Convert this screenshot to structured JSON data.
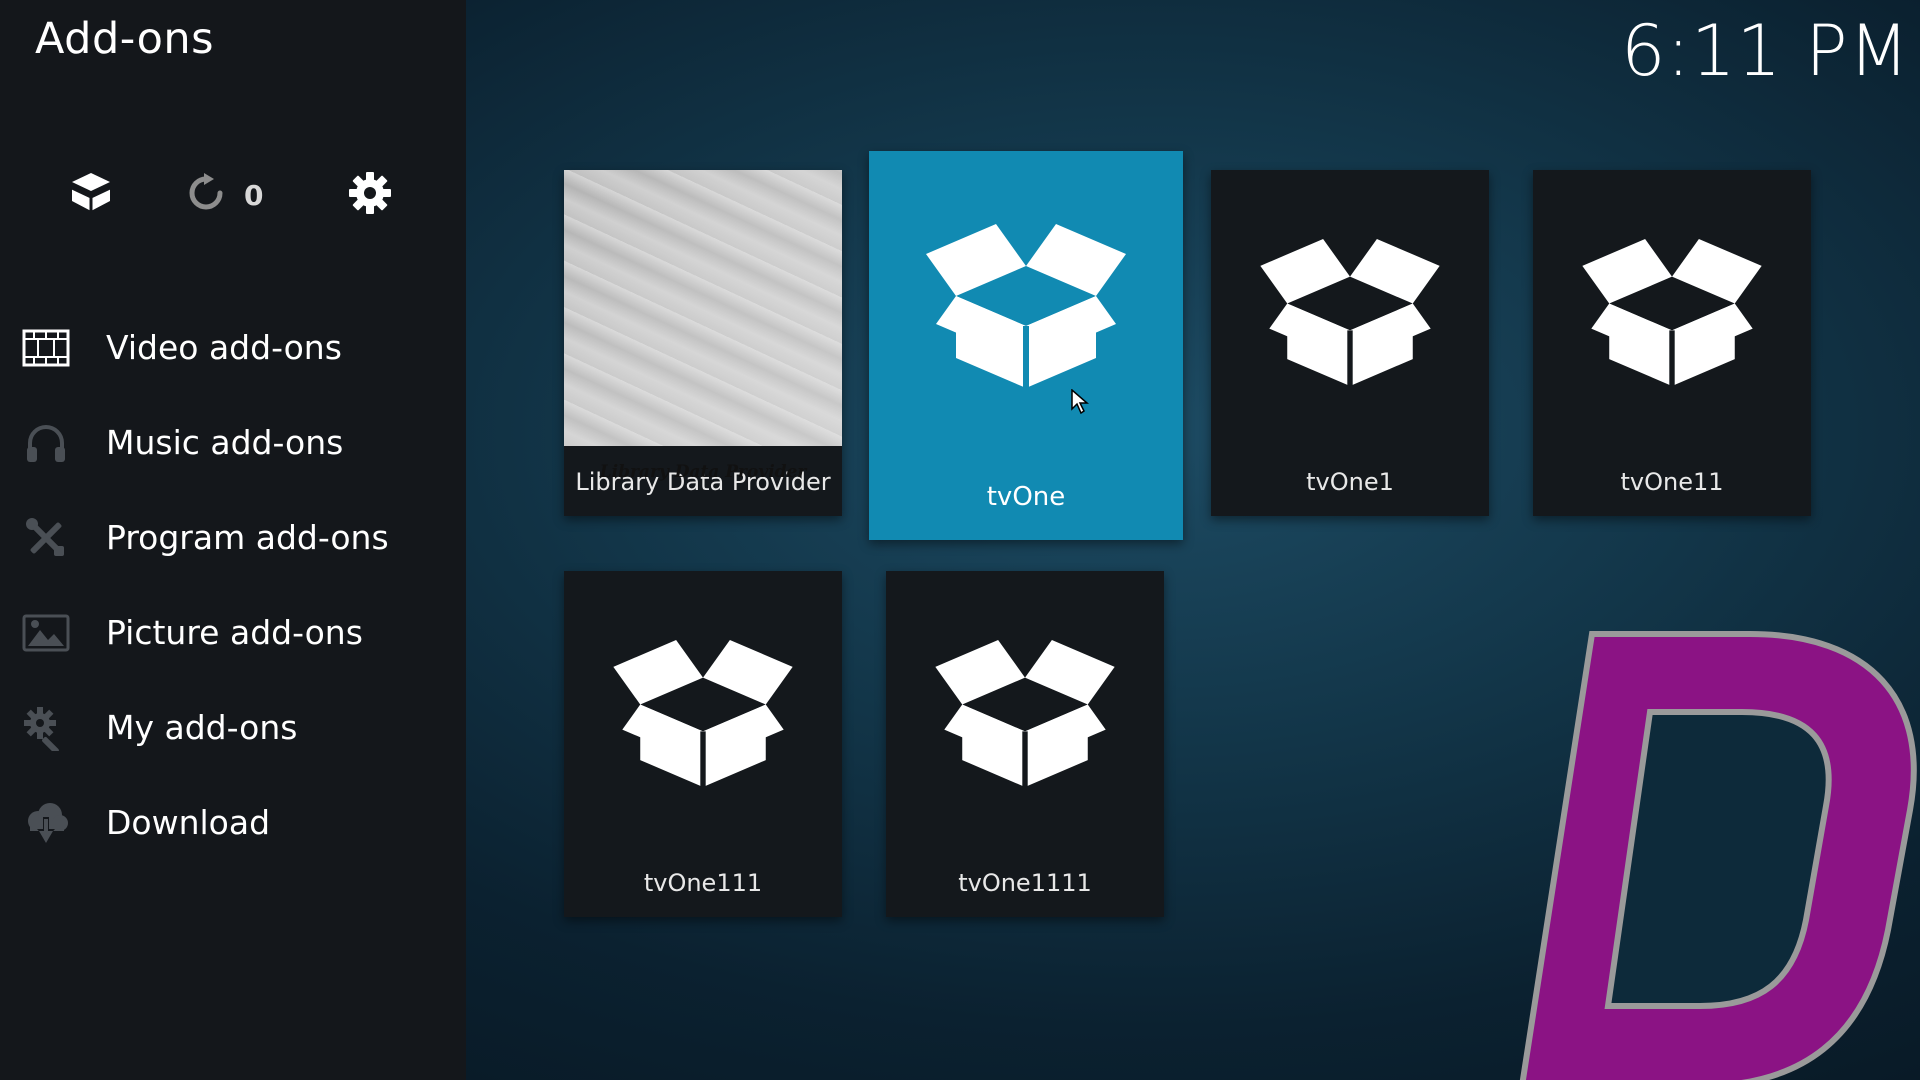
{
  "header": {
    "title": "Add-ons",
    "clock": "6:11 PM"
  },
  "toolbar": {
    "installer_icon": "open-box-icon",
    "update_icon": "refresh-icon",
    "update_count": "0",
    "settings_icon": "gear-icon"
  },
  "sidebar": {
    "items": [
      {
        "label": "Video add-ons",
        "icon": "film-strip-icon"
      },
      {
        "label": "Music add-ons",
        "icon": "headphones-icon"
      },
      {
        "label": "Program add-ons",
        "icon": "tools-icon"
      },
      {
        "label": "Picture add-ons",
        "icon": "picture-icon"
      },
      {
        "label": "My add-ons",
        "icon": "gears-icon"
      },
      {
        "label": "Download",
        "icon": "cloud-download-icon"
      }
    ]
  },
  "addons": [
    {
      "label": "Library Data Provider",
      "poster_text": "Library Data Provider",
      "focused": false
    },
    {
      "label": "tvOne",
      "focused": true
    },
    {
      "label": "tvOne1",
      "focused": false
    },
    {
      "label": "tvOne11",
      "focused": false
    },
    {
      "label": "tvOne111",
      "focused": false
    },
    {
      "label": "tvOne1111",
      "focused": false
    }
  ],
  "watermark": {
    "letter": "D",
    "fill_color": "#8b1384",
    "stroke_color": "#9a9a9a"
  },
  "colors": {
    "focus_accent": "#118ab2",
    "sidebar_bg": "#14171b",
    "tile_bg": "#14181c"
  }
}
